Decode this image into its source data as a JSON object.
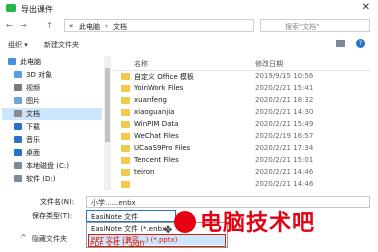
{
  "window": {
    "title": "导出课件",
    "close_glyph": "✕"
  },
  "address": {
    "back": "←",
    "forward": "→",
    "up": "↑",
    "crumbs": [
      "«",
      "此电脑",
      "›",
      "文档"
    ],
    "search_placeholder": "搜索\"文档\""
  },
  "toolbar": {
    "organize": "组织 ▾",
    "new_folder": "新建文件夹"
  },
  "nav": {
    "items": [
      {
        "label": "此电脑",
        "icon": "computer-icon",
        "color": "#4a90d9"
      },
      {
        "label": "3D 对象",
        "icon": "cube-icon",
        "color": "#5aa0e0"
      },
      {
        "label": "视频",
        "icon": "video-icon",
        "color": "#7a7a7a"
      },
      {
        "label": "图片",
        "icon": "picture-icon",
        "color": "#6aa7d8"
      },
      {
        "label": "文档",
        "icon": "document-icon",
        "color": "#8a8a8a",
        "selected": true
      },
      {
        "label": "下载",
        "icon": "download-icon",
        "color": "#2a72c6"
      },
      {
        "label": "音乐",
        "icon": "music-icon",
        "color": "#2a72c6"
      },
      {
        "label": "桌面",
        "icon": "desktop-icon",
        "color": "#2a72c6"
      },
      {
        "label": "本地磁盘 (C:)",
        "icon": "drive-icon",
        "color": "#7a8a99"
      },
      {
        "label": "软件 (D:)",
        "icon": "drive-icon",
        "color": "#7a8a99"
      }
    ]
  },
  "list": {
    "columns": {
      "name": "名称",
      "date": "修改日期"
    },
    "rows": [
      {
        "name": "自定义 Office 模板",
        "date": "2019/9/15 10:56"
      },
      {
        "name": "YoinWork Files",
        "date": "2020/2/21 15:41"
      },
      {
        "name": "xuanfeng",
        "date": "2020/2/21 18:32"
      },
      {
        "name": "xiaoguanjia",
        "date": "2020/2/21 14:30"
      },
      {
        "name": "WinPIM Data",
        "date": "2020/2/21 15:49"
      },
      {
        "name": "WeChat Files",
        "date": "2020/2/19 16:57"
      },
      {
        "name": "UCaaS9Pro Files",
        "date": "2020/2/21 17:34"
      },
      {
        "name": "Tencent Files",
        "date": "2020/2/21 15:01"
      },
      {
        "name": "teiron",
        "date": "2020/2/21 14:46"
      },
      {
        "name": "",
        "date": "2020/2/21 14:46"
      }
    ]
  },
  "save": {
    "filename_label": "文件名(N):",
    "filename_value": "小学......enbx",
    "type_label": "保存类型(T):",
    "type_value": "EasiNote 文件",
    "options": [
      "EasiNote 文件 (*.enbx)",
      "PPT 文件 (兼容...) (*.pptx)",
      "PDF 文件 (*.pdf)"
    ],
    "hide_folders": "隐藏文件夹"
  },
  "watermark": {
    "text": "电脑技术吧"
  }
}
